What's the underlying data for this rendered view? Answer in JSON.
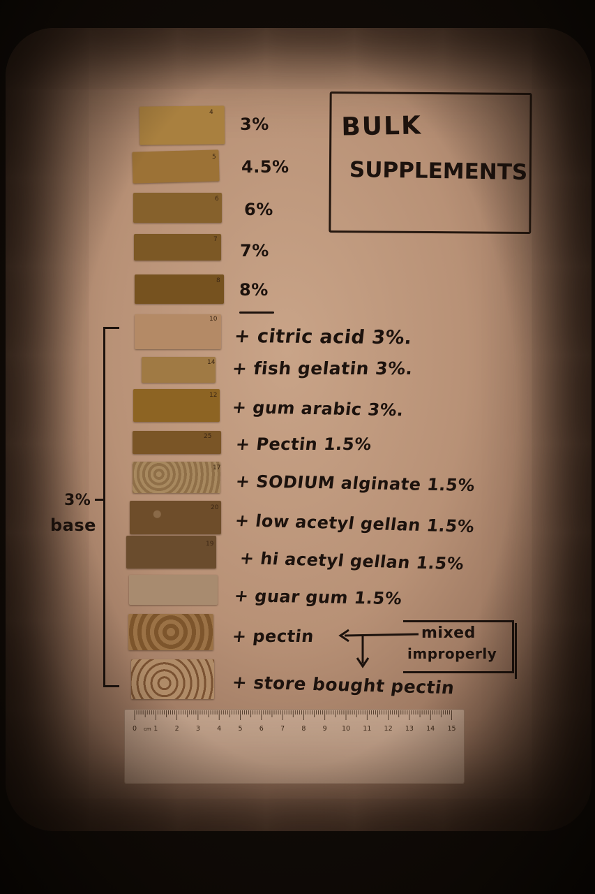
{
  "title": {
    "line1": "BULK",
    "line2": "SUPPLEMENTS"
  },
  "concentration_rows": [
    {
      "label": "3%",
      "swatch_number": "4",
      "color": "#a9803f"
    },
    {
      "label": "4.5%",
      "swatch_number": "5",
      "color": "#9c7236"
    },
    {
      "label": "6%",
      "swatch_number": "6",
      "color": "#86612c"
    },
    {
      "label": "7%",
      "swatch_number": "7",
      "color": "#7c5825"
    },
    {
      "label": "8%",
      "swatch_number": "8",
      "color": "#76521f"
    }
  ],
  "additive_rows": [
    {
      "label": "+ citric acid 3%.",
      "swatch_number": "10",
      "color": "#b48a66"
    },
    {
      "label": "+ fish gelatin 3%.",
      "swatch_number": "14",
      "color": "#a07a44"
    },
    {
      "label": "+ gum arabic 3%.",
      "swatch_number": "12",
      "color": "#8d6423"
    },
    {
      "label": "+ Pectin 1.5%",
      "swatch_number": "25",
      "color": "#7a5526"
    },
    {
      "label": "+ SODIUM alginate 1.5%",
      "swatch_number": "17",
      "color": "#9c7b55"
    },
    {
      "label": "+ low acetyl gellan 1.5%",
      "swatch_number": "20",
      "color": "#6e4d2a"
    },
    {
      "label": "+ hi acetyl gellan 1.5%",
      "swatch_number": "19",
      "color": "#6a4c2d"
    },
    {
      "label": "+ guar gum 1.5%",
      "swatch_number": "",
      "color": "#a88b6f"
    },
    {
      "label": "+ pectin",
      "swatch_number": "",
      "color": "#8d6236"
    },
    {
      "label": "+ store bought pectin",
      "swatch_number": "",
      "color": "#a17c5a"
    }
  ],
  "bracket_label": {
    "line1": "3%",
    "line2": "base"
  },
  "note": {
    "line1": "mixed",
    "line2": "improperly"
  },
  "ruler": {
    "unit": "cm",
    "ticks": [
      "0",
      "1",
      "2",
      "3",
      "4",
      "5",
      "6",
      "7",
      "8",
      "9",
      "10",
      "11",
      "12",
      "13",
      "14",
      "15"
    ]
  },
  "colors": {
    "ink": "#1c120d",
    "paper": "#c9a488",
    "background": "#100b07"
  }
}
